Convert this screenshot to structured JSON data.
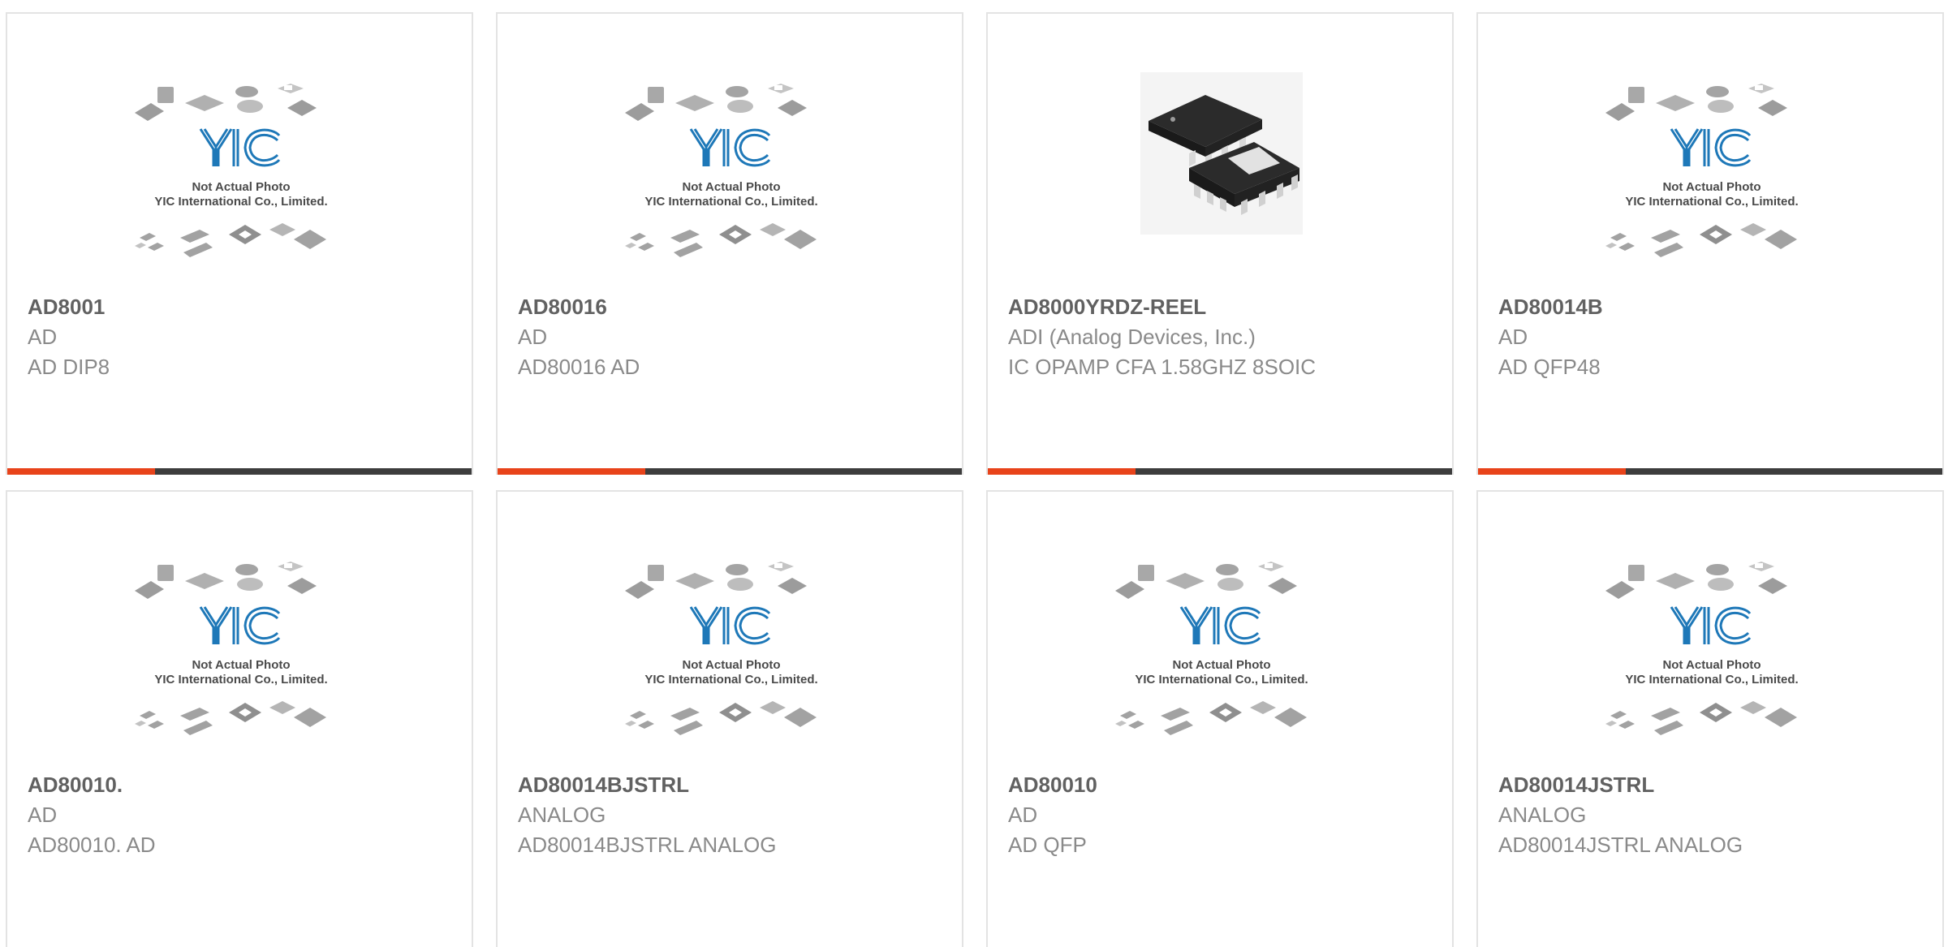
{
  "products": [
    {
      "part": "AD8001",
      "maker": "AD",
      "desc": "AD DIP8",
      "image": "placeholder",
      "placeholder_lines": [
        "Not Actual Photo",
        "YIC International Co., Limited."
      ]
    },
    {
      "part": "AD80016",
      "maker": "AD",
      "desc": "AD80016 AD",
      "image": "placeholder",
      "placeholder_lines": [
        "Not Actual Photo",
        "YIC International Co., Limited."
      ]
    },
    {
      "part": "AD8000YRDZ-REEL",
      "maker": "ADI (Analog Devices, Inc.)",
      "desc": "IC OPAMP CFA 1.58GHZ 8SOIC",
      "image": "soic8-photo"
    },
    {
      "part": "AD80014B",
      "maker": "AD",
      "desc": "AD QFP48",
      "image": "placeholder",
      "placeholder_lines": [
        "Not Actual Photo",
        "YIC International Co., Limited."
      ]
    },
    {
      "part": "AD80010.",
      "maker": "AD",
      "desc": "AD80010. AD",
      "image": "placeholder",
      "placeholder_lines": [
        "Not Actual Photo",
        "YIC International Co., Limited."
      ]
    },
    {
      "part": "AD80014BJSTRL",
      "maker": "ANALOG",
      "desc": "AD80014BJSTRL ANALOG",
      "image": "placeholder",
      "placeholder_lines": [
        "Not Actual Photo",
        "YIC International Co., Limited."
      ]
    },
    {
      "part": "AD80010",
      "maker": "AD",
      "desc": "AD QFP",
      "image": "placeholder",
      "placeholder_lines": [
        "Not Actual Photo",
        "YIC International Co., Limited."
      ]
    },
    {
      "part": "AD80014JSTRL",
      "maker": "ANALOG",
      "desc": "AD80014JSTRL ANALOG",
      "image": "placeholder",
      "placeholder_lines": [
        "Not Actual Photo",
        "YIC International Co., Limited."
      ]
    }
  ],
  "logo_text": "YIC",
  "colors": {
    "accent": "#e8431a",
    "bar": "#3d3d3d",
    "logo_blue": "#1e78b8",
    "part_text": "#616161",
    "meta_text": "#8a8a8a",
    "border": "#e3e3e3"
  }
}
